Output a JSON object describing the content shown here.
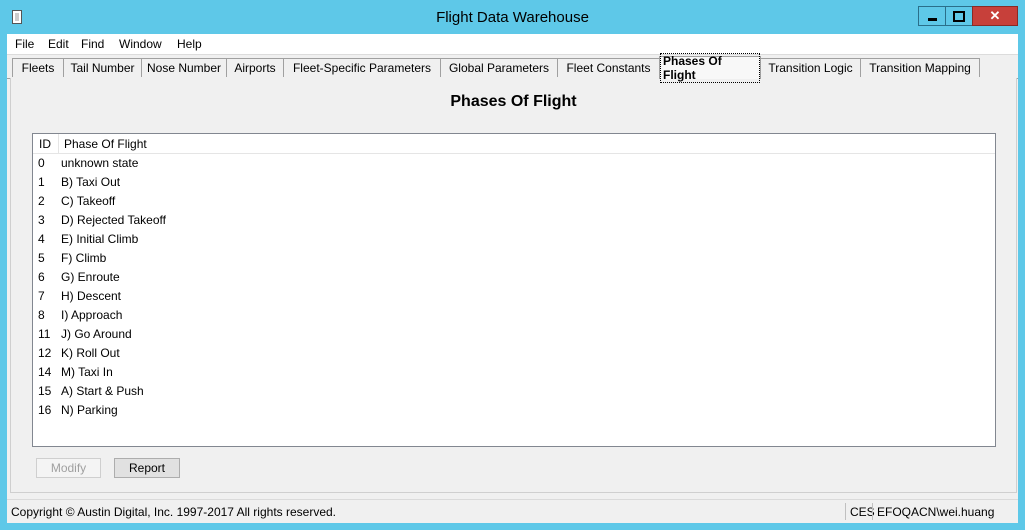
{
  "window": {
    "title": "Flight Data Warehouse"
  },
  "menu": [
    "File",
    "Edit",
    "Find",
    "Window",
    "Help"
  ],
  "tabs": [
    "Fleets",
    "Tail Number",
    "Nose Number",
    "Airports",
    "Fleet-Specific Parameters",
    "Global Parameters",
    "Fleet Constants",
    "Phases Of Flight",
    "Transition Logic",
    "Transition Mapping"
  ],
  "active_tab": "Phases Of Flight",
  "page": {
    "title": "Phases Of Flight",
    "columns": [
      "ID",
      "Phase Of Flight"
    ],
    "rows": [
      {
        "id": "0",
        "phase": "unknown state"
      },
      {
        "id": "1",
        "phase": "B) Taxi Out"
      },
      {
        "id": "2",
        "phase": "C) Takeoff"
      },
      {
        "id": "3",
        "phase": "D) Rejected Takeoff"
      },
      {
        "id": "4",
        "phase": "E) Initial Climb"
      },
      {
        "id": "5",
        "phase": "F) Climb"
      },
      {
        "id": "6",
        "phase": "G) Enroute"
      },
      {
        "id": "7",
        "phase": "H) Descent"
      },
      {
        "id": "8",
        "phase": "I) Approach"
      },
      {
        "id": "11",
        "phase": "J) Go Around"
      },
      {
        "id": "12",
        "phase": "K) Roll Out"
      },
      {
        "id": "14",
        "phase": "M) Taxi In"
      },
      {
        "id": "15",
        "phase": "A) Start & Push"
      },
      {
        "id": "16",
        "phase": "N) Parking"
      }
    ],
    "buttons": {
      "modify": "Modify",
      "report": "Report"
    }
  },
  "status": {
    "copyright": "Copyright © Austin Digital, Inc. 1997-2017 All rights reserved.",
    "org": "CES",
    "user": "EFOQACN\\wei.huang"
  },
  "colors": {
    "titlebar": "#5ec8e8",
    "close": "#c7403a",
    "client": "#f0f0f0"
  }
}
